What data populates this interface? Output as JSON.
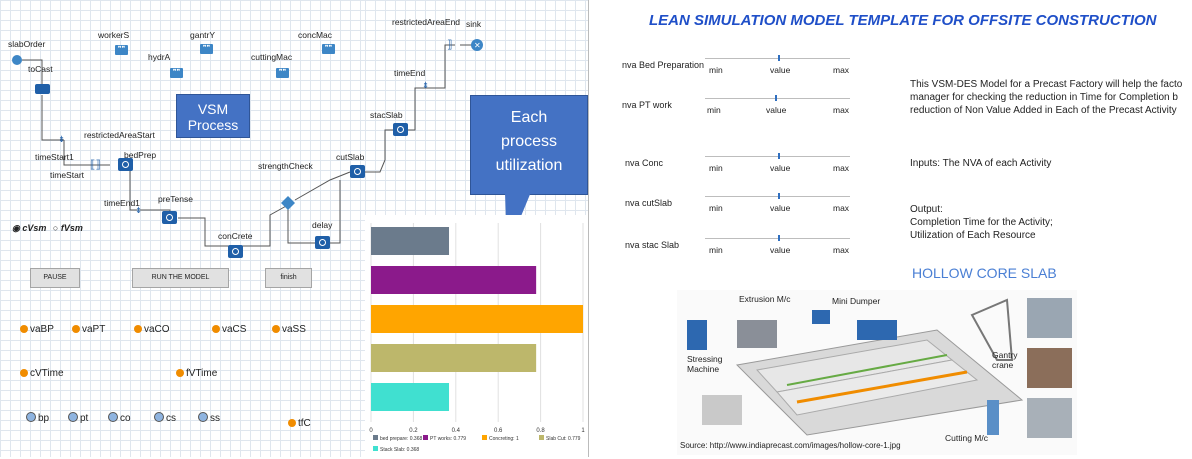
{
  "flow": {
    "nodes": [
      {
        "id": "slabOrder",
        "label": "slabOrder"
      },
      {
        "id": "toCast",
        "label": "toCast"
      },
      {
        "id": "timeStart1",
        "label": "timeStart1"
      },
      {
        "id": "timeStart",
        "label": "timeStart"
      },
      {
        "id": "restrictedAreaStart",
        "label": "restrictedAreaStart"
      },
      {
        "id": "bedPrep",
        "label": "bedPrep"
      },
      {
        "id": "timeEnd1",
        "label": "timeEnd1"
      },
      {
        "id": "preTense",
        "label": "preTense"
      },
      {
        "id": "conCrete",
        "label": "conCrete"
      },
      {
        "id": "strengthCheck",
        "label": "strengthCheck"
      },
      {
        "id": "delay",
        "label": "delay"
      },
      {
        "id": "cutSlab",
        "label": "cutSlab"
      },
      {
        "id": "stacSlab",
        "label": "stacSlab"
      },
      {
        "id": "timeEnd",
        "label": "timeEnd"
      },
      {
        "id": "restrictedAreaEnd",
        "label": "restrictedAreaEnd"
      },
      {
        "id": "sink",
        "label": "sink"
      }
    ],
    "resources": [
      "workerS",
      "gantrY",
      "concMac",
      "hydrA",
      "cuttingMac"
    ],
    "callout_vsm": "VSM Process",
    "callout_util": "Each process utilization",
    "radio": {
      "option1": "cVsm",
      "option2": "fVsm",
      "selected": "cVsm"
    }
  },
  "controls": {
    "pause": "PAUSE",
    "run": "RUN THE MODEL",
    "finish": "finish"
  },
  "variables": {
    "row1": [
      "vaBP",
      "vaPT",
      "vaCO",
      "vaCS",
      "vaSS"
    ],
    "cVTime": "cVTime",
    "fVTime": "fVTime",
    "tfC": "tfC"
  },
  "functions": [
    "bp",
    "pt",
    "co",
    "cs",
    "ss"
  ],
  "chart_data": {
    "type": "bar",
    "orientation": "horizontal",
    "categories": [
      "bed prepare",
      "PT works",
      "Concreting",
      "Slab Cut",
      "Stack Slab"
    ],
    "values": [
      0.368,
      0.779,
      1,
      0.779,
      0.368
    ],
    "colors": [
      "#6b7b8c",
      "#8b1a8b",
      "#ffa500",
      "#bdb76b",
      "#40e0d0"
    ],
    "legend": [
      "bed prepare: 0.368",
      "PT works: 0.779",
      "Concreting: 1",
      "Slab Cut: 0.779",
      "Stack Slab: 0.368"
    ],
    "xlim": [
      0,
      1
    ],
    "xticks": [
      "0",
      "0.2",
      "0.4",
      "0.6",
      "0.8",
      "1"
    ]
  },
  "right": {
    "title": "LEAN SIMULATION  MODEL TEMPLATE FOR OFFSITE CONSTRUCTION",
    "sliders": [
      {
        "label": "nva Bed Preparation",
        "min": "min",
        "value": "value",
        "max": "max"
      },
      {
        "label": "nva PT work",
        "min": "min",
        "value": "value",
        "max": "max"
      },
      {
        "label": "nva Conc",
        "min": "min",
        "value": "value",
        "max": "max"
      },
      {
        "label": "nva cutSlab",
        "min": "min",
        "value": "value",
        "max": "max"
      },
      {
        "label": "nva stac Slab",
        "min": "min",
        "value": "value",
        "max": "max"
      }
    ],
    "desc1": [
      "This VSM-DES Model for a Precast Factory will help the facto",
      " manager for checking the reduction in Time for Completion b",
      "reduction of Non Value Added in Each of the Precast Activity"
    ],
    "inputs": "Inputs: The NVA of each Activity",
    "output": [
      "Output:",
      "Completion Time for the Activity;",
      "Utilization of Each Resource"
    ],
    "hollow": "HOLLOW CORE SLAB",
    "photo_labels": {
      "extrusion": "Extrusion M/c",
      "dumper": "Mini Dumper",
      "stressing": "Stressing Machine",
      "gantry": "Gantry crane",
      "cutting": "Cutting M/c"
    },
    "source": "Source: http://www.indiaprecast.com/images/hollow-core-1.jpg"
  }
}
